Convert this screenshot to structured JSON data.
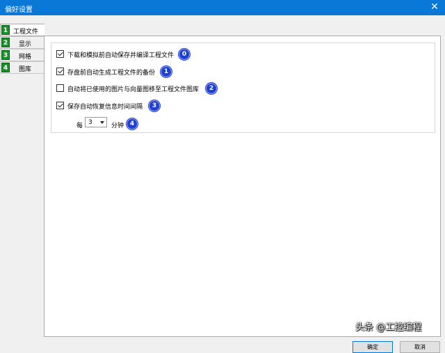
{
  "window": {
    "title": "偏好设置",
    "close_glyph": "✕"
  },
  "tabs": [
    {
      "num": "1",
      "label": "工程文件",
      "active": true
    },
    {
      "num": "2",
      "label": "显示"
    },
    {
      "num": "3",
      "label": "网格"
    },
    {
      "num": "4",
      "label": "图库"
    }
  ],
  "options": [
    {
      "label": "下载和模拟前自动保存并编译工程文件",
      "checked": true,
      "badge": "0"
    },
    {
      "label": "存盘前自动生成工程文件的备份",
      "checked": true,
      "badge": "1"
    },
    {
      "label": "自动将已使用的图片与向量图移至工程文件图库",
      "checked": false,
      "badge": "2"
    },
    {
      "label": "保存自动恢复信息时间间隔",
      "checked": true,
      "badge": "3"
    }
  ],
  "interval": {
    "prefix": "每",
    "value": "3",
    "suffix": "分钟",
    "badge": "4"
  },
  "buttons": {
    "ok": "确定",
    "cancel": "取消"
  },
  "watermark": "头条 @工控编程"
}
